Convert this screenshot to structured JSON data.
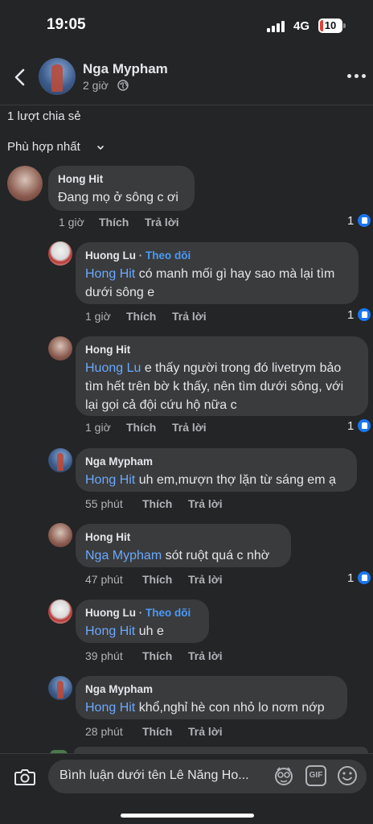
{
  "status_bar": {
    "time": "19:05",
    "network": "4G",
    "battery": "10"
  },
  "header": {
    "name": "Nga Mypham",
    "time": "2 giờ"
  },
  "shares": "1 lượt chia sẻ",
  "sort_label": "Phù hợp nhất",
  "comments": [
    {
      "author": "Hong Hit",
      "text": "Đang mọ ở sông c ơi",
      "time": "1 giờ",
      "like": "Thích",
      "reply": "Trả lời",
      "likes": "1"
    },
    {
      "author": "Huong Lu",
      "follow_sep": " · ",
      "follow": "Theo dõi",
      "mention": "Hong Hit",
      "text_line1": " có manh mối gì hay sao mà lại tìm",
      "text_line2": "dưới sông e",
      "time": "1 giờ",
      "like": "Thích",
      "reply": "Trả lời",
      "likes": "1"
    },
    {
      "author": "Hong Hit",
      "mention": "Huong Lu",
      "text_line1": " e thấy người trong đó livetrym bảo",
      "text_line2": "tìm hết trên bờ k thấy, nên tìm dưới sông, với",
      "text_line3": "lại gọi cả đội cứu hộ nữa c",
      "time": "1 giờ",
      "like": "Thích",
      "reply": "Trả lời",
      "likes": "1"
    },
    {
      "author": "Nga Mypham",
      "mention": "Hong Hit",
      "text": " uh em,mượn thợ lặn từ sáng em ạ",
      "time": "55 phút",
      "like": "Thích",
      "reply": "Trả lời"
    },
    {
      "author": "Hong Hit",
      "mention": "Nga Mypham",
      "text": " sót ruột quá c nhờ",
      "time": "47 phút",
      "like": "Thích",
      "reply": "Trả lời",
      "likes": "1"
    },
    {
      "author": "Huong Lu",
      "follow_sep": " · ",
      "follow": "Theo dõi",
      "mention": "Hong Hit",
      "text": " uh e",
      "time": "39 phút",
      "like": "Thích",
      "reply": "Trả lời"
    },
    {
      "author": "Nga Mypham",
      "mention": "Hong Hit",
      "text": " khổ,nghỉ hè con nhỏ lo nơm nớp",
      "time": "28 phút",
      "like": "Thích",
      "reply": "Trả lời"
    }
  ],
  "composer": {
    "placeholder": "Bình luận dưới tên Lê Năng Ho...",
    "gif_label": "GIF"
  },
  "icons": {
    "back": "chevron-left-icon",
    "globe": "globe-icon",
    "more": "more-horizontal-icon",
    "camera": "camera-icon",
    "sticker": "sticker-icon",
    "gif": "gif-icon",
    "emoji": "emoji-icon",
    "like": "thumbs-up-icon"
  },
  "colors": {
    "background": "#242526",
    "bubble": "#3a3b3c",
    "mention": "#6aa8ff",
    "link": "#4b9af6",
    "like": "#1877f2"
  }
}
